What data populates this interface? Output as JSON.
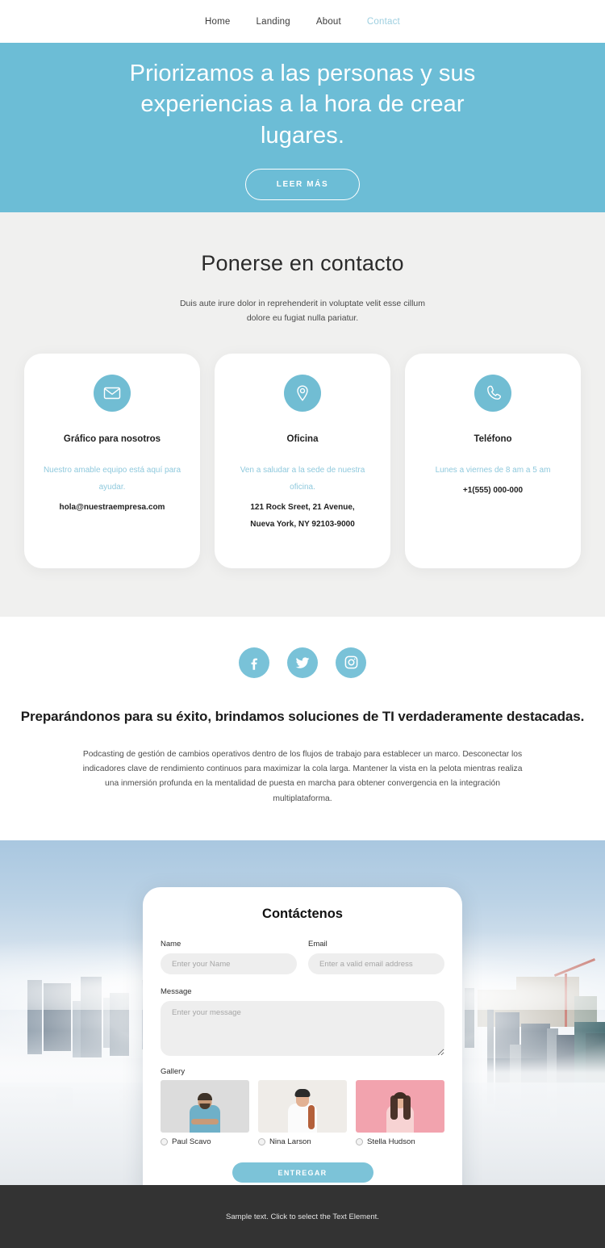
{
  "nav": {
    "items": [
      {
        "label": "Home",
        "active": false
      },
      {
        "label": "Landing",
        "active": false
      },
      {
        "label": "About",
        "active": false
      },
      {
        "label": "Contact",
        "active": true
      }
    ]
  },
  "hero": {
    "title": "Priorizamos a las personas y sus experiencias a la hora de crear lugares.",
    "button": "LEER MÁS",
    "bg_color": "#6cbdd6"
  },
  "contact": {
    "title": "Ponerse en contacto",
    "subtitle": "Duis aute irure dolor in reprehenderit in voluptate velit esse cillum dolore eu fugiat nulla pariatur.",
    "cards": [
      {
        "icon": "envelope-icon",
        "title": "Gráfico para nosotros",
        "desc": "Nuestro amable equipo está aquí para ayudar.",
        "info": "hola@nuestraempresa.com"
      },
      {
        "icon": "map-pin-icon",
        "title": "Oficina",
        "desc": "Ven a saludar a la sede de nuestra oficina.",
        "info": "121 Rock Sreet, 21 Avenue,\nNueva York, NY 92103-9000"
      },
      {
        "icon": "phone-icon",
        "title": "Teléfono",
        "desc": "Lunes a viernes de 8 am a 5 am",
        "info": "+1(555) 000-000"
      }
    ],
    "accent_color": "#71bdd3"
  },
  "about": {
    "socials": [
      {
        "icon": "facebook-icon",
        "name": "Facebook"
      },
      {
        "icon": "twitter-icon",
        "name": "Twitter"
      },
      {
        "icon": "instagram-icon",
        "name": "Instagram"
      }
    ],
    "title": "Preparándonos para su éxito, brindamos soluciones de TI verdaderamente destacadas.",
    "text": "Podcasting de gestión de cambios operativos dentro de los flujos de trabajo para establecer un marco. Desconectar los indicadores clave de rendimiento continuos para maximizar la cola larga. Mantener la vista en la pelota mientras realiza una inmersión profunda en la mentalidad de puesta en marcha para obtener convergencia en la integración multiplataforma."
  },
  "form": {
    "title": "Contáctenos",
    "name_label": "Name",
    "name_placeholder": "Enter your Name",
    "name_value": "",
    "email_label": "Email",
    "email_placeholder": "Enter a valid email address",
    "email_value": "",
    "message_label": "Message",
    "message_placeholder": "Enter your message",
    "message_value": "",
    "gallery_label": "Gallery",
    "gallery": [
      {
        "name": "Paul Scavo",
        "selected": false,
        "bg": "#dcdcdc"
      },
      {
        "name": "Nina Larson",
        "selected": false,
        "bg": "#efece8"
      },
      {
        "name": "Stella Hudson",
        "selected": false,
        "bg": "#f2a3ae"
      }
    ],
    "submit_label": "ENTREGAR",
    "submit_color": "#7cc3d8"
  },
  "footer": {
    "text": "Sample text. Click to select the Text Element.",
    "bg_color": "#333333"
  }
}
